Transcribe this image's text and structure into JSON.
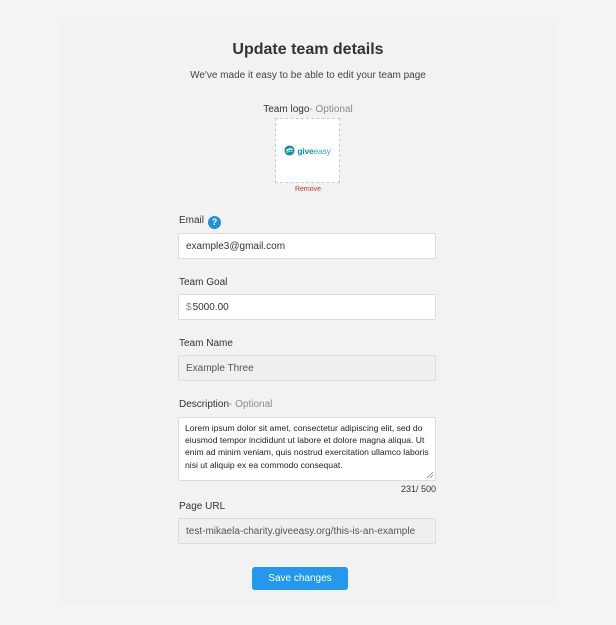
{
  "header": {
    "title": "Update team details",
    "subtitle": "We've made it easy to be able to edit your team page"
  },
  "logo": {
    "label": "Team logo",
    "optional": "- Optional",
    "brand_main": "give",
    "brand_accent": "easy",
    "remove_label": "Remove"
  },
  "email": {
    "label": "Email",
    "help_icon": "?",
    "value": "example3@gmail.com"
  },
  "goal": {
    "label": "Team Goal",
    "prefix": "$",
    "value": "5000.00"
  },
  "team_name": {
    "label": "Team Name",
    "value": "Example Three"
  },
  "description": {
    "label": "Description",
    "optional": "- Optional",
    "value": "Lorem ipsum dolor sit amet, consectetur adipiscing elit, sed do eiusmod tempor incididunt ut labore et dolore magna aliqua. Ut enim ad minim veniam, quis nostrud exercitation ullamco laboris nisi ut aliquip ex ea commodo consequat.",
    "counter": "231/ 500"
  },
  "page_url": {
    "label": "Page URL",
    "value": "test-mikaela-charity.giveeasy.org/this-is-an-example"
  },
  "actions": {
    "save_label": "Save changes"
  },
  "colors": {
    "primary": "#2299ee",
    "remove": "#c0392b",
    "brand": "#1a8fa7"
  }
}
